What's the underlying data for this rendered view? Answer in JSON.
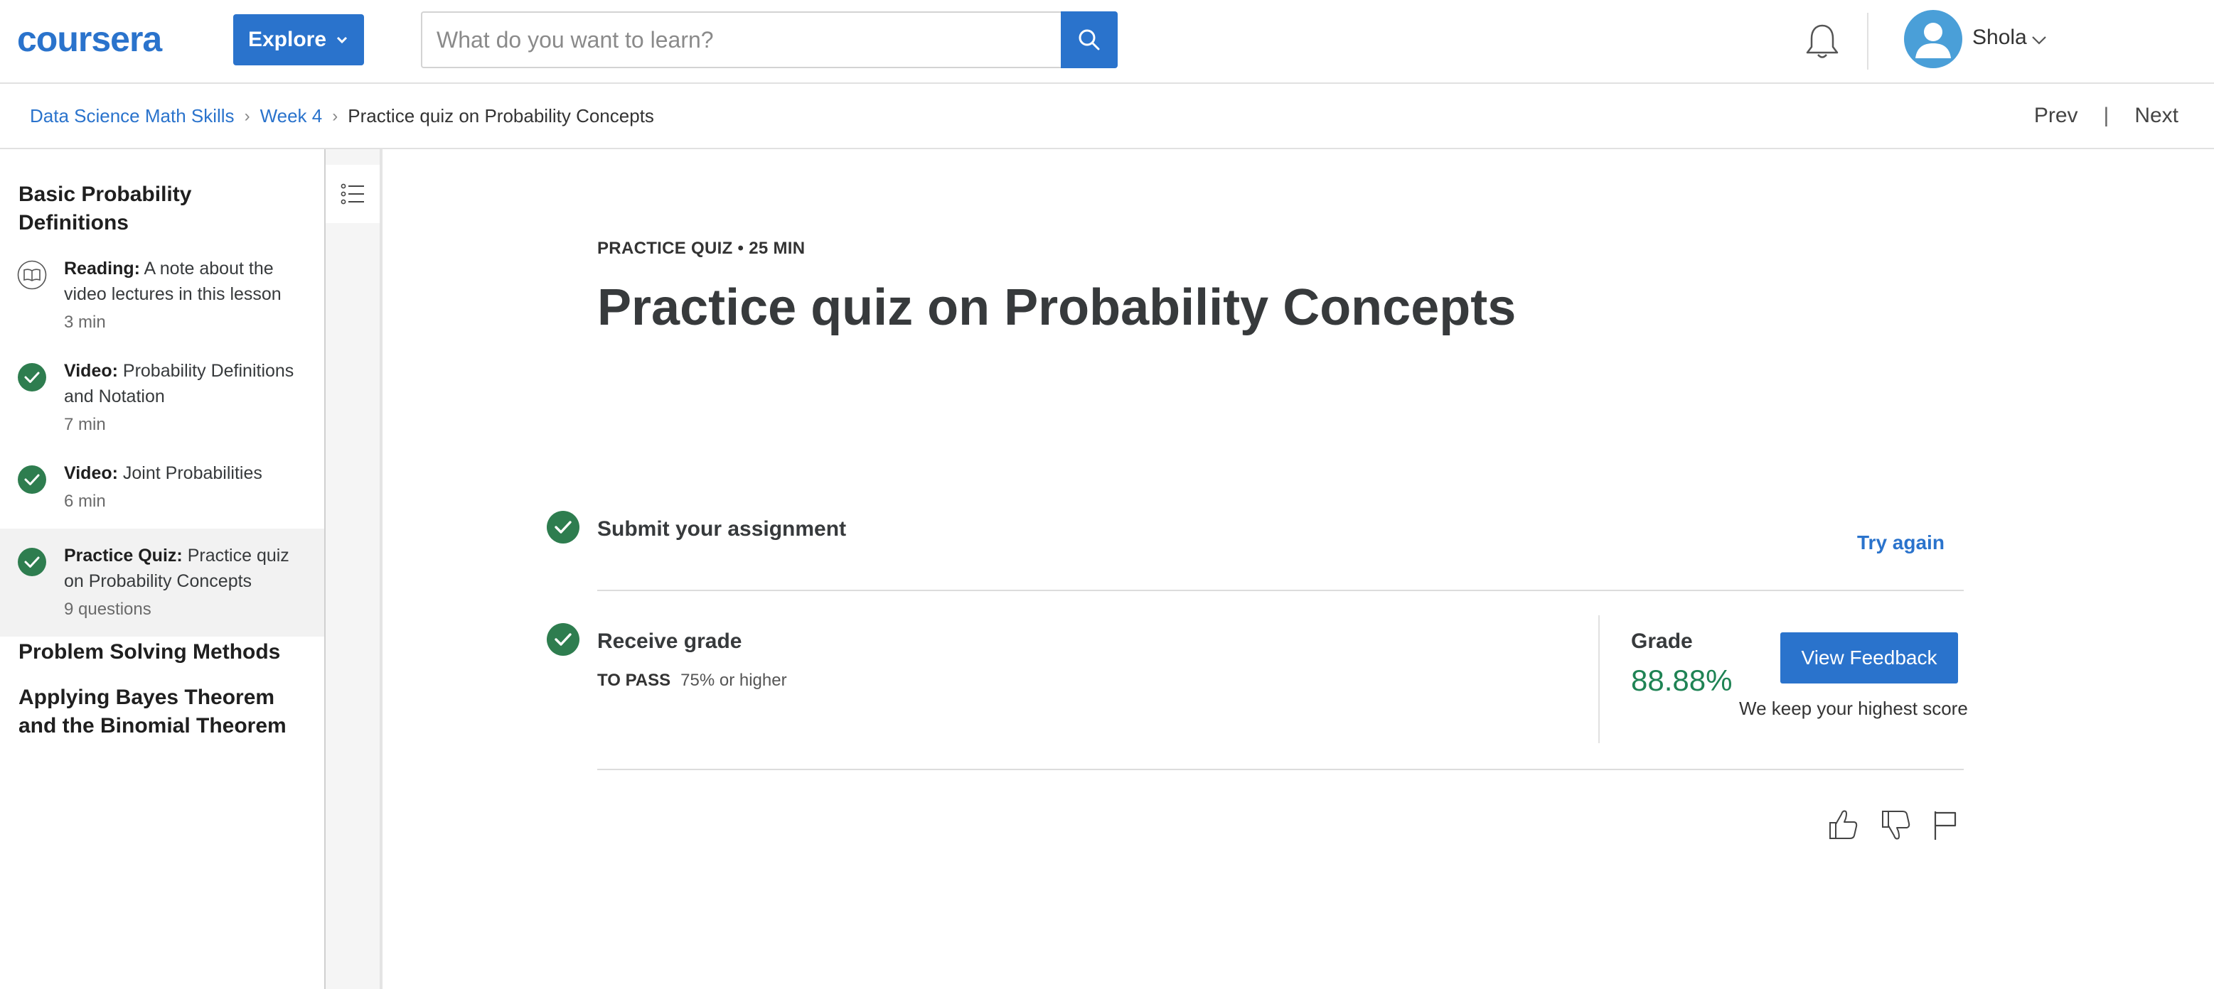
{
  "header": {
    "logo": "coursera",
    "explore_label": "Explore",
    "search_placeholder": "What do you want to learn?",
    "user_name": "Shola"
  },
  "breadcrumb": {
    "items": [
      "Data Science Math Skills",
      "Week 4"
    ],
    "current": "Practice quiz on Probability Concepts",
    "prev_label": "Prev",
    "next_label": "Next"
  },
  "sidebar": {
    "section1": "Basic Probability Definitions",
    "items": [
      {
        "type": "Reading:",
        "title": "A note about the video lectures in this lesson",
        "meta": "3 min",
        "status": "reading"
      },
      {
        "type": "Video:",
        "title": "Probability Definitions and Notation",
        "meta": "7 min",
        "status": "complete"
      },
      {
        "type": "Video:",
        "title": "Joint Probabilities",
        "meta": "6 min",
        "status": "complete"
      },
      {
        "type": "Practice Quiz:",
        "title": "Practice quiz on Probability Concepts",
        "meta": "9 questions",
        "status": "complete"
      }
    ],
    "section2": "Problem Solving Methods",
    "section3": "Applying Bayes Theorem and the Binomial Theorem"
  },
  "main": {
    "eyebrow": "PRACTICE QUIZ • 25 MIN",
    "title": "Practice quiz on Probability Concepts",
    "submit_title": "Submit your assignment",
    "try_again": "Try again",
    "receive_title": "Receive grade",
    "to_pass_label": "TO PASS",
    "to_pass_value": "75% or higher",
    "grade_label": "Grade",
    "grade_value": "88.88%",
    "view_feedback": "View Feedback",
    "keep_note": "We keep your highest score"
  },
  "colors": {
    "brand_blue": "#2a73cc",
    "success_green": "#2e7d4f",
    "grade_green": "#1f8354"
  },
  "icons": {
    "search": "search-icon",
    "bell": "bell-icon",
    "avatar": "user-avatar-icon",
    "outline": "outline-list-icon",
    "like": "thumbs-up-icon",
    "dislike": "thumbs-down-icon",
    "flag": "flag-icon"
  }
}
